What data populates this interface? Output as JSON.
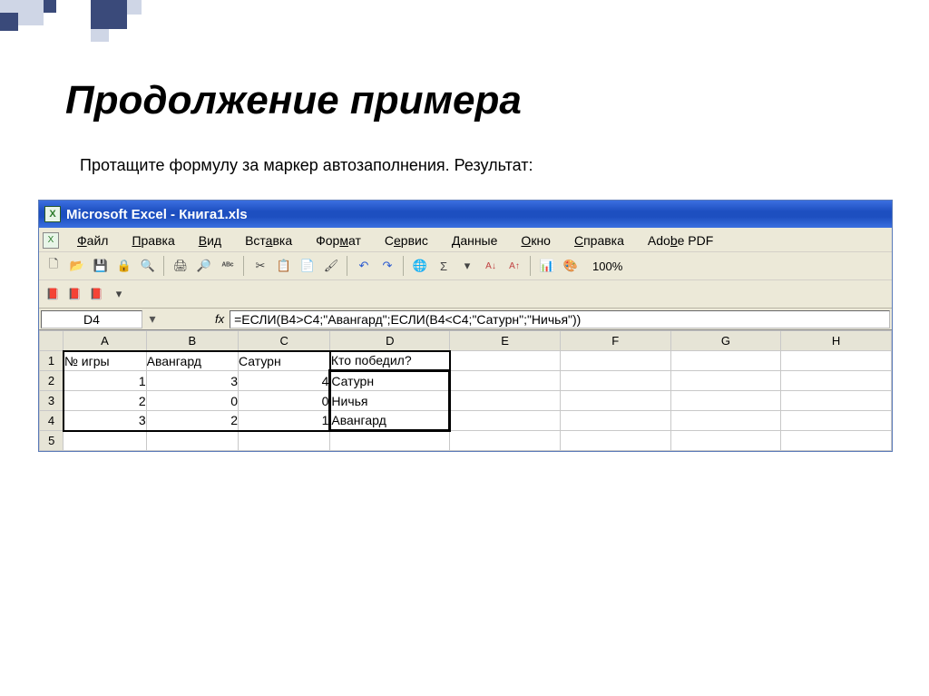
{
  "slide": {
    "title": "Продолжение примера",
    "subtitle": "Протащите формулу за маркер автозаполнения. Результат:"
  },
  "window": {
    "title": "Microsoft Excel - Книга1.xls"
  },
  "menu": {
    "file": "Файл",
    "edit": "Правка",
    "view": "Вид",
    "insert": "Вставка",
    "format": "Формат",
    "service": "Сервис",
    "data": "Данные",
    "window": "Окно",
    "help": "Справка",
    "adobe": "Adobe PDF"
  },
  "toolbar": {
    "zoom": "100%"
  },
  "formula_bar": {
    "cell_ref": "D4",
    "fx_label": "fx",
    "formula": "=ЕСЛИ(B4>C4;\"Авангард\";ЕСЛИ(B4<C4;\"Сатурн\";\"Ничья\"))"
  },
  "columns": [
    "A",
    "B",
    "C",
    "D",
    "E",
    "F",
    "G",
    "H"
  ],
  "row_numbers": [
    "1",
    "2",
    "3",
    "4",
    "5"
  ],
  "grid": {
    "headers": {
      "A1": "№ игры",
      "B1": "Авангард",
      "C1": "Сатурн",
      "D1": "Кто победил?"
    },
    "rows": [
      {
        "num": "1",
        "a": "1",
        "b": "3",
        "c": "4",
        "d": "Сатурн"
      },
      {
        "num": "2",
        "a": "2",
        "b": "0",
        "c": "0",
        "d": "Ничья"
      },
      {
        "num": "3",
        "a": "3",
        "b": "2",
        "c": "1",
        "d": "Авангард"
      }
    ]
  }
}
